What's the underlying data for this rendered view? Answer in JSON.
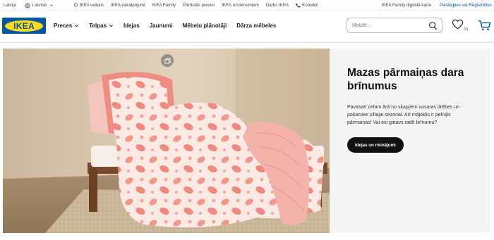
{
  "topbar": {
    "country": "Latvija",
    "language": "Latviski",
    "links": [
      {
        "label": "IKEA veikals",
        "icon": "store-icon"
      },
      {
        "label": "IKEA pakalpojumi",
        "icon": ""
      },
      {
        "label": "IKEA Family",
        "icon": ""
      },
      {
        "label": "Pārdotās preces",
        "icon": ""
      },
      {
        "label": "IKEA uzņēmumiem",
        "icon": ""
      },
      {
        "label": "Darbs IKEA",
        "icon": ""
      },
      {
        "label": "Kontakti",
        "icon": "phone-icon"
      }
    ],
    "family_card": "IKEA Family digitālā karte",
    "login": "Pieslēgties vai Reģistrēties"
  },
  "nav": {
    "logo_text": "IKEA",
    "menu": [
      {
        "label": "Preces",
        "dropdown": true
      },
      {
        "label": "Telpas",
        "dropdown": true
      },
      {
        "label": "Idejas",
        "dropdown": false
      },
      {
        "label": "Jaunumi",
        "dropdown": false
      },
      {
        "label": "Mēbeļu plānotāji",
        "dropdown": false
      },
      {
        "label": "Dārza mēbeles",
        "dropdown": false
      }
    ],
    "search_placeholder": "Meklēt...",
    "wishlist_count": "(0)"
  },
  "promo": {
    "title": "Mazas pārmaiņas dara brīnumus",
    "text": "Pavasarī celam ārā no skapjiem vasaras drēbes un pošamies siltajai sezonai. Arī mājoklis ir pelnījis pārmaiņas! Vai esi gatavs radīt brīnumu?",
    "button": "Idejas un risinājumi"
  },
  "colors": {
    "brand_blue": "#0058a3",
    "brand_yellow": "#ffda1a",
    "link_blue": "#0058a3",
    "bedding_coral": "#f08c80",
    "panel_bg": "#f5f5f5"
  }
}
